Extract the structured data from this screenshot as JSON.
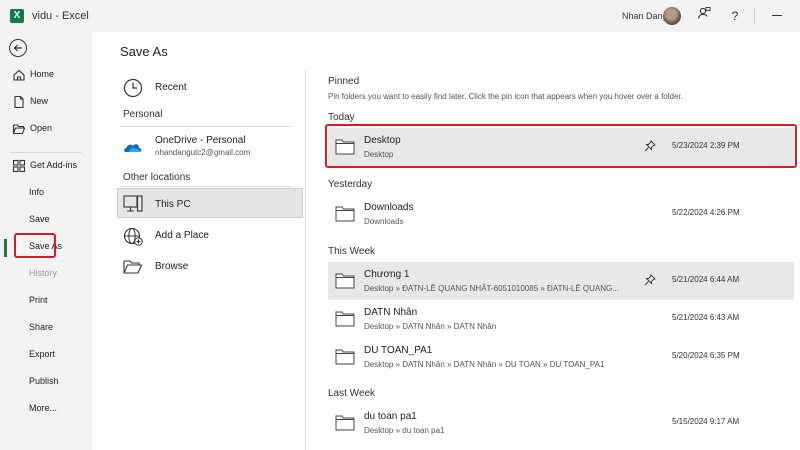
{
  "titlebar": {
    "logo": "X",
    "doc_title": "vidu  -  Excel",
    "user_name": "Nhan Dang",
    "icons": [
      "person-feedback-icon",
      "help-icon",
      "minimize-icon"
    ],
    "help_label": "?"
  },
  "nav": {
    "items": [
      {
        "label": "Home",
        "icon": "home-icon"
      },
      {
        "label": "New",
        "icon": "new-document-icon"
      },
      {
        "label": "Open",
        "icon": "open-folder-icon"
      },
      {
        "label": "Get Add-ins",
        "icon": "add-ins-icon"
      },
      {
        "label": "Info"
      },
      {
        "label": "Save"
      },
      {
        "label": "Save As",
        "selected": true
      },
      {
        "label": "History",
        "disabled": true
      },
      {
        "label": "Print"
      },
      {
        "label": "Share"
      },
      {
        "label": "Export"
      },
      {
        "label": "Publish"
      },
      {
        "label": "More..."
      }
    ]
  },
  "page_title": "Save As",
  "locations": {
    "recent": "Recent",
    "personal_head": "Personal",
    "onedrive": {
      "label": "OneDrive - Personal",
      "email": "nhandangutc2@gmail.com"
    },
    "other_head": "Other locations",
    "this_pc": "This PC",
    "add_place": "Add a Place",
    "browse": "Browse"
  },
  "folders": {
    "pinned_head": "Pinned",
    "pinned_desc": "Pin folders you want to easily find later. Click the pin icon that appears when you hover over a folder.",
    "sections": [
      {
        "head": "Today",
        "rows": [
          {
            "name": "Desktop",
            "path": "Desktop",
            "date": "5/23/2024 2:39 PM",
            "pinned": true,
            "highlight": true
          }
        ]
      },
      {
        "head": "Yesterday",
        "rows": [
          {
            "name": "Downloads",
            "path": "Downloads",
            "date": "5/22/2024 4:26 PM"
          }
        ]
      },
      {
        "head": "This Week",
        "rows": [
          {
            "name": "Chương 1",
            "path": "Desktop » ĐATN-LÊ QUANG NHẬT-6051010085 » ĐATN-LÊ QUANG...",
            "date": "5/21/2024 6:44 AM",
            "pinned": true,
            "highlight": true
          },
          {
            "name": "DATN Nhân",
            "path": "Desktop » DATN Nhân » DATN Nhân",
            "date": "5/21/2024 6:43 AM"
          },
          {
            "name": "DU TOAN_PA1",
            "path": "Desktop » DATN Nhân » DATN Nhân » DU TOAN » DU TOAN_PA1",
            "date": "5/20/2024 6:35 PM"
          }
        ]
      },
      {
        "head": "Last Week",
        "rows": [
          {
            "name": "du toan pa1",
            "path": "Desktop » du toan pa1",
            "date": "5/15/2024 9:17 AM"
          }
        ]
      }
    ]
  },
  "colors": {
    "excel_green": "#217346",
    "annotation_red": "#d11d2a",
    "highlight_gray": "#e8e8e8"
  }
}
